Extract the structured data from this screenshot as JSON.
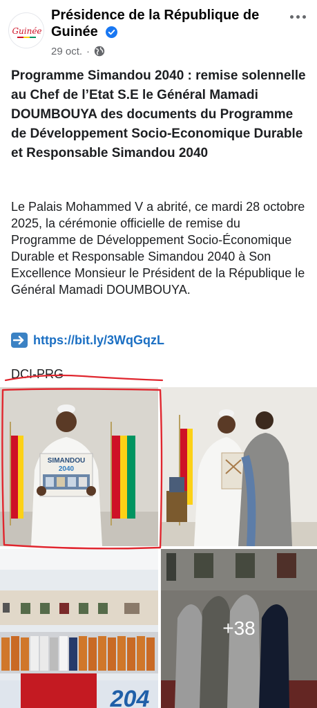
{
  "post": {
    "author": "Présidence de la République de Guinée",
    "avatar_text": "Guinée",
    "date": "29 oct.",
    "title": "Programme Simandou 2040 : remise solennelle au Chef de l’Etat S.E le Général Mamadi DOUMBOUYA des documents du Programme de Développement Socio-Economique Durable et Responsable Simandou 2040",
    "body": "Le Palais Mohammed V a abrité, ce mardi 28 octobre 2025, la cérémonie officielle de remise du Programme de Développement Socio-Économique Durable et Responsable Simandou 2040 à Son Excellence Monsieur le Président de la République le Général Mamadi DOUMBOUYA.",
    "link": "https://bit.ly/3WqGqzL",
    "signature": "DCI-PRG"
  },
  "photos": {
    "photo1_banner": "SIMANDOU",
    "photo1_banner_year": "2040",
    "photo3_banner": "204",
    "more_count": "+38"
  },
  "icons": {
    "verified": "verified-badge-icon",
    "audience": "globe-icon",
    "more": "more-options-icon",
    "link_arrow": "right-arrow-icon"
  },
  "colors": {
    "link": "#1b6fc3",
    "verified": "#1877f2",
    "annotation": "#e0262e",
    "guinea_red": "#ce1126",
    "guinea_yellow": "#fcd116",
    "guinea_green": "#009460"
  }
}
